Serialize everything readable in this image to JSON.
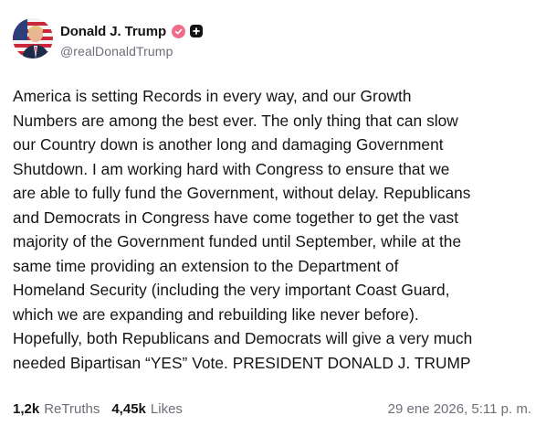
{
  "post": {
    "author": {
      "display_name": "Donald J. Trump",
      "handle": "@realDonaldTrump",
      "verified_icon": "verified-check-icon",
      "plus_icon": "plus-square-icon"
    },
    "text": "America is setting Records in every way, and our Growth\nNumbers are among the best ever. The only thing that can slow\nour Country down is another long and damaging Government\nShutdown. I am working hard with Congress to ensure that we\nare able to fully fund the Government, without delay. Republicans\nand Democrats in Congress have come together to get the vast\nmajority of the Government funded until September, while at the\nsame time providing an extension to the Department of\nHomeland Security (including the very important Coast Guard,\nwhich we are expanding and rebuilding like never before).\nHopefully, both Republicans and Democrats will give a very much\nneeded Bipartisan “YES” Vote. PRESIDENT DONALD J. TRUMP",
    "stats": {
      "retruths_count": "1,2k",
      "retruths_label": "ReTruths",
      "likes_count": "4,45k",
      "likes_label": "Likes"
    },
    "timestamp": "29 ene 2026, 5:11 p. m."
  },
  "colors": {
    "verified_badge": "#ef6d88",
    "secondary_text": "#6c6f78",
    "primary_text": "#141414"
  }
}
